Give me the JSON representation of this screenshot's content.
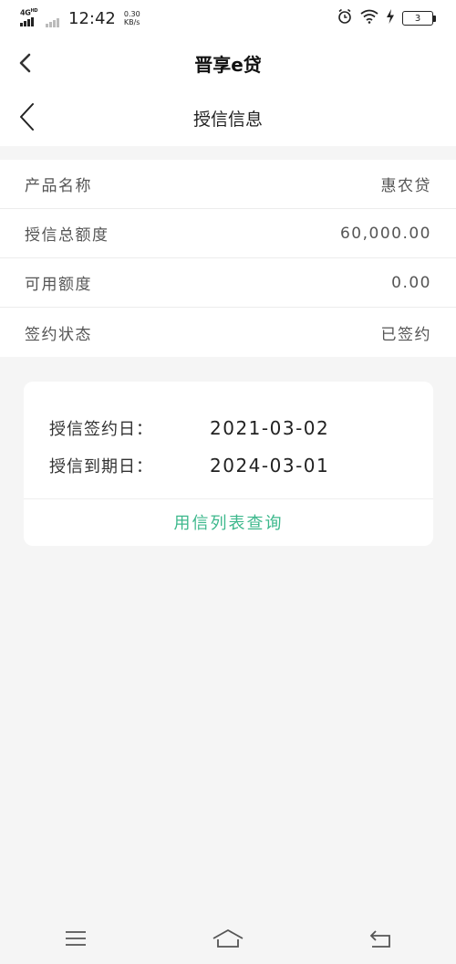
{
  "status_bar": {
    "network": "4G",
    "network_sup": "HD",
    "time": "12:42",
    "speed_value": "0.30",
    "speed_unit": "KB/s",
    "battery_level": "3"
  },
  "app_header": {
    "title": "晋享e贷",
    "back_icon": "chevron-left-icon"
  },
  "page_header": {
    "title": "授信信息",
    "back_icon": "chevron-left-icon"
  },
  "info_rows": [
    {
      "label": "产品名称",
      "value": "惠农贷"
    },
    {
      "label": "授信总额度",
      "value": "60,000.00"
    },
    {
      "label": "可用额度",
      "value": "0.00"
    },
    {
      "label": "签约状态",
      "value": "已签约"
    }
  ],
  "card": {
    "sign_date_label": "授信签约日：",
    "sign_date_value": "2021-03-02",
    "expire_date_label": "授信到期日：",
    "expire_date_value": "2024-03-01",
    "action_label": "用信列表查询"
  },
  "nav_bar": {
    "menu_icon": "menu-icon",
    "home_icon": "home-icon",
    "back_icon": "back-icon"
  },
  "colors": {
    "accent": "#3db88c",
    "background": "#f5f5f5"
  }
}
